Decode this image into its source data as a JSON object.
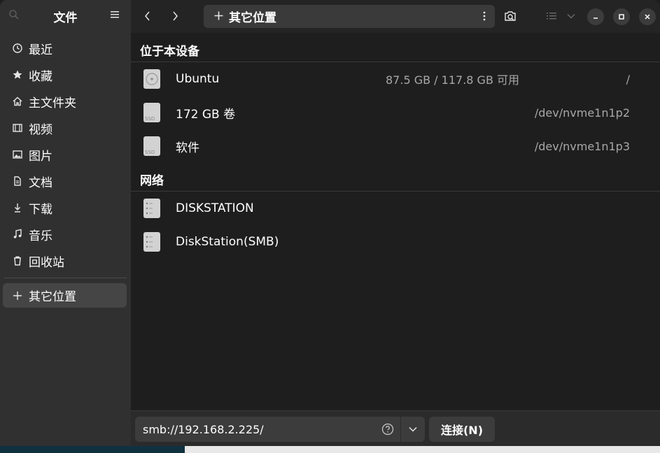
{
  "sidebar": {
    "title": "文件",
    "items": [
      {
        "label": "最近",
        "icon": "clock-icon"
      },
      {
        "label": "收藏",
        "icon": "star-icon"
      },
      {
        "label": "主文件夹",
        "icon": "home-icon"
      },
      {
        "label": "视频",
        "icon": "film-icon"
      },
      {
        "label": "图片",
        "icon": "image-icon"
      },
      {
        "label": "文档",
        "icon": "document-icon"
      },
      {
        "label": "下载",
        "icon": "download-icon"
      },
      {
        "label": "音乐",
        "icon": "music-icon"
      },
      {
        "label": "回收站",
        "icon": "trash-icon"
      }
    ],
    "active_item": {
      "label": "其它位置",
      "icon": "plus-icon"
    }
  },
  "header": {
    "path_label": "其它位置"
  },
  "sections": {
    "local": {
      "title": "位于本设备",
      "devices": [
        {
          "name": "Ubuntu",
          "info": "87.5 GB / 117.8 GB 可用",
          "path": "/",
          "icon": "disk-icon"
        },
        {
          "name": "172 GB 卷",
          "info": "",
          "path": "/dev/nvme1n1p2",
          "icon": "ssd-icon"
        },
        {
          "name": "软件",
          "info": "",
          "path": "/dev/nvme1n1p3",
          "icon": "ssd-icon"
        }
      ]
    },
    "network": {
      "title": "网络",
      "devices": [
        {
          "name": "DISKSTATION",
          "icon": "server-icon"
        },
        {
          "name": "DiskStation(SMB)",
          "icon": "server-icon"
        }
      ]
    }
  },
  "bottom": {
    "server_value": "smb://192.168.2.225/",
    "connect_label": "连接(N)"
  },
  "colors": {
    "window_bg": "#242424",
    "sidebar_bg": "#303030",
    "content_bg": "#1e1e1e",
    "button_bg": "#3c3c3c",
    "secondary_text": "#a8a8a8"
  }
}
